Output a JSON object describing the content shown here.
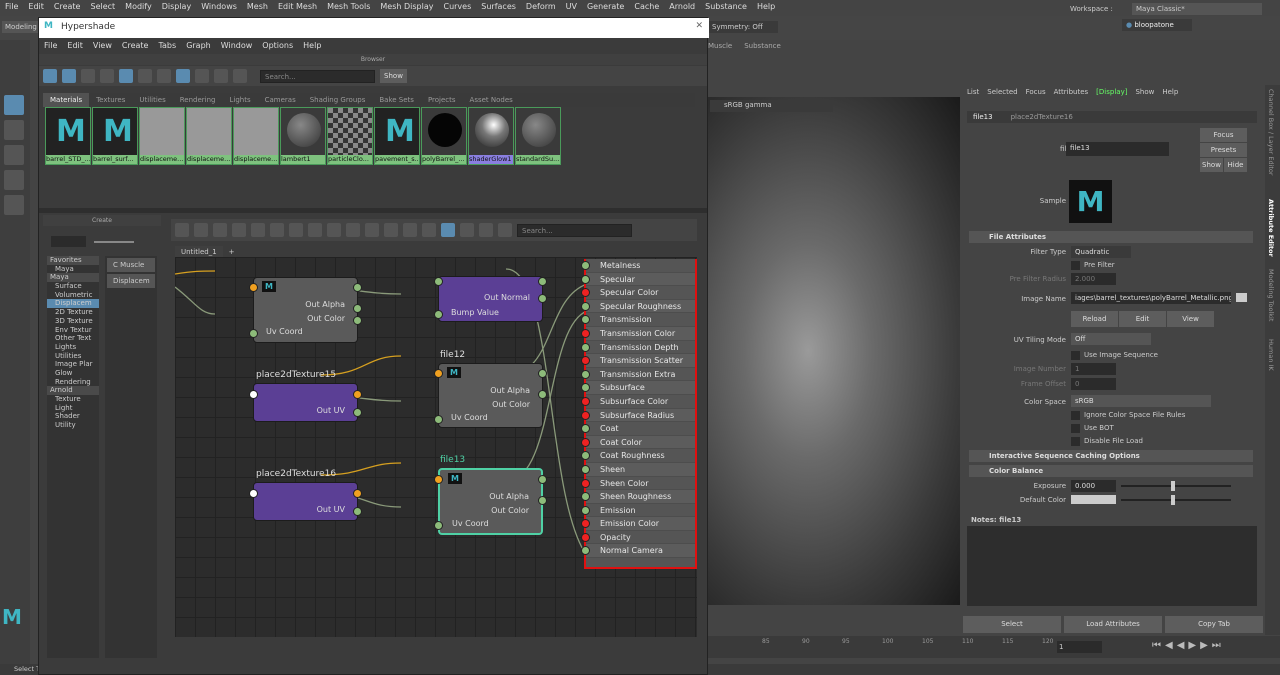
{
  "menubar": [
    "File",
    "Edit",
    "Create",
    "Select",
    "Modify",
    "Display",
    "Windows",
    "Mesh",
    "Edit Mesh",
    "Mesh Tools",
    "Mesh Display",
    "Curves",
    "Surfaces",
    "Deform",
    "UV",
    "Generate",
    "Cache",
    "Arnold",
    "Substance",
    "Help"
  ],
  "shelf": {
    "mode": "Modeling",
    "symmetry": "Symmetry: Off",
    "workspace_label": "Workspace :",
    "workspace": "Maya Classic*",
    "user": "bloopatone",
    "shelf_tabs": [
      "Muscle",
      "Substance"
    ]
  },
  "hypershade": {
    "title": "Hypershade",
    "menu": [
      "File",
      "Edit",
      "View",
      "Create",
      "Tabs",
      "Graph",
      "Window",
      "Options",
      "Help"
    ],
    "browser": {
      "header": "Browser",
      "search_placeholder": "Search...",
      "show_label": "Show",
      "tabs": [
        "Materials",
        "Textures",
        "Utilities",
        "Rendering",
        "Lights",
        "Cameras",
        "Shading Groups",
        "Bake Sets",
        "Projects",
        "Asset Nodes"
      ],
      "swatches": [
        {
          "label": "barrel_STD_...",
          "type": "maya"
        },
        {
          "label": "barrel_surf...",
          "type": "maya"
        },
        {
          "label": "displaceme...",
          "type": "disp"
        },
        {
          "label": "displaceme...",
          "type": "disp"
        },
        {
          "label": "displaceme...",
          "type": "disp"
        },
        {
          "label": "lambert1",
          "type": "sphere"
        },
        {
          "label": "particleClo...",
          "type": "checker"
        },
        {
          "label": "pavement_s...",
          "type": "maya"
        },
        {
          "label": "polyBarrel_...",
          "type": "dark"
        },
        {
          "label": "shaderGlow1",
          "type": "glow",
          "selected": true
        },
        {
          "label": "standardSu...",
          "type": "sphere2"
        }
      ]
    },
    "create": {
      "header": "Create",
      "tree": [
        {
          "label": "Favorites",
          "level": 0,
          "hdr": true
        },
        {
          "label": "Maya",
          "level": 1
        },
        {
          "label": "Maya",
          "level": 0,
          "hdr": true
        },
        {
          "label": "Surface",
          "level": 1
        },
        {
          "label": "Volumetric",
          "level": 1
        },
        {
          "label": "Displacem",
          "level": 1,
          "selected": true
        },
        {
          "label": "2D Texture",
          "level": 1
        },
        {
          "label": "3D Texture",
          "level": 1
        },
        {
          "label": "Env Textur",
          "level": 1
        },
        {
          "label": "Other Text",
          "level": 1
        },
        {
          "label": "Lights",
          "level": 1
        },
        {
          "label": "Utilities",
          "level": 1
        },
        {
          "label": "Image Plar",
          "level": 1
        },
        {
          "label": "Glow",
          "level": 1
        },
        {
          "label": "Rendering",
          "level": 1
        },
        {
          "label": "Arnold",
          "level": 0,
          "hdr": true
        },
        {
          "label": "Texture",
          "level": 1
        },
        {
          "label": "Light",
          "level": 1
        },
        {
          "label": "Shader",
          "level": 1
        },
        {
          "label": "Utility",
          "level": 1
        }
      ],
      "list": [
        "C Muscle",
        "Displacem"
      ]
    },
    "node_editor": {
      "search_placeholder": "Search...",
      "tab": "Untitled_1",
      "add_tab": "+",
      "nodes": {
        "file_top": {
          "outputs": [
            "Out Alpha",
            "Out Color"
          ],
          "input": "Uv Coord"
        },
        "bump": {
          "output": "Out Normal",
          "input": "Bump Value"
        },
        "place15": {
          "label": "place2dTexture15",
          "output": "Out UV"
        },
        "file12": {
          "label": "file12",
          "outputs": [
            "Out Alpha",
            "Out Color"
          ],
          "input": "Uv Coord"
        },
        "place16": {
          "label": "place2dTexture16",
          "output": "Out UV"
        },
        "file13": {
          "label": "file13",
          "outputs": [
            "Out Alpha",
            "Out Color"
          ],
          "input": "Uv Coord"
        }
      },
      "material_attrs": [
        "Metalness",
        "Specular",
        "Specular Color",
        "Specular Roughness",
        "Transmission",
        "Transmission Color",
        "Transmission Depth",
        "Transmission Scatter",
        "Transmission Extra Rough",
        "Subsurface",
        "Subsurface Color",
        "Subsurface Radius",
        "Coat",
        "Coat Color",
        "Coat Roughness",
        "Sheen",
        "Sheen Color",
        "Sheen Roughness",
        "Emission",
        "Emission Color",
        "Opacity",
        "Normal Camera"
      ],
      "color_attrs": [
        "Specular Color",
        "Transmission Color",
        "Transmission Scatter",
        "Subsurface Color",
        "Subsurface Radius",
        "Coat Color",
        "Sheen Color",
        "Emission Color",
        "Opacity"
      ]
    }
  },
  "viewport": {
    "color_space": "sRGB gamma"
  },
  "attribute_editor": {
    "menu": [
      "List",
      "Selected",
      "Focus",
      "Attributes",
      "[Display]",
      "Show",
      "Help"
    ],
    "tabs": [
      "file13",
      "place2dTexture16"
    ],
    "file_label": "file:",
    "file_value": "file13",
    "buttons": {
      "focus": "Focus",
      "presets": "Presets",
      "show": "Show",
      "hide": "Hide"
    },
    "sample_label": "Sample",
    "file_attributes": {
      "title": "File Attributes",
      "filter_type_label": "Filter Type",
      "filter_type": "Quadratic",
      "pre_filter": "Pre Filter",
      "pre_filter_radius_label": "Pre Filter Radius",
      "pre_filter_radius": "2.000",
      "image_name_label": "Image Name",
      "image_name": "iages\\barrel_textures\\polyBarrel_Metallic.png",
      "reload": "Reload",
      "edit": "Edit",
      "view": "View",
      "uv_tiling_label": "UV Tiling Mode",
      "uv_tiling": "Off",
      "use_image_sequence": "Use Image Sequence",
      "image_number_label": "Image Number",
      "image_number": "1",
      "frame_offset_label": "Frame Offset",
      "frame_offset": "0",
      "color_space_label": "Color Space",
      "color_space": "sRGB",
      "ignore_rules": "Ignore Color Space File Rules",
      "use_bot": "Use BOT",
      "disable_load": "Disable File Load"
    },
    "interactive_caching": "Interactive Sequence Caching Options",
    "color_balance": {
      "title": "Color Balance",
      "exposure_label": "Exposure",
      "exposure": "0.000",
      "default_color_label": "Default Color"
    },
    "notes": "Notes:  file13",
    "bottom_buttons": [
      "Select",
      "Load Attributes",
      "Copy Tab"
    ]
  },
  "side_tabs": [
    "Channel Box / Layer Editor",
    "Attribute Editor",
    "Modeling Toolkit",
    "Human IK"
  ],
  "timeline": {
    "ticks": [
      "85",
      "90",
      "95",
      "100",
      "105",
      "110",
      "115",
      "120"
    ],
    "current": "1"
  },
  "status": "Select Tool: select an object",
  "colors": {
    "accent": "#5a8bb0",
    "material_green": "#7ec27e",
    "selected_node": "#4fd1a5",
    "shader_border": "#e01010",
    "purple_node": "#5b3f95"
  }
}
